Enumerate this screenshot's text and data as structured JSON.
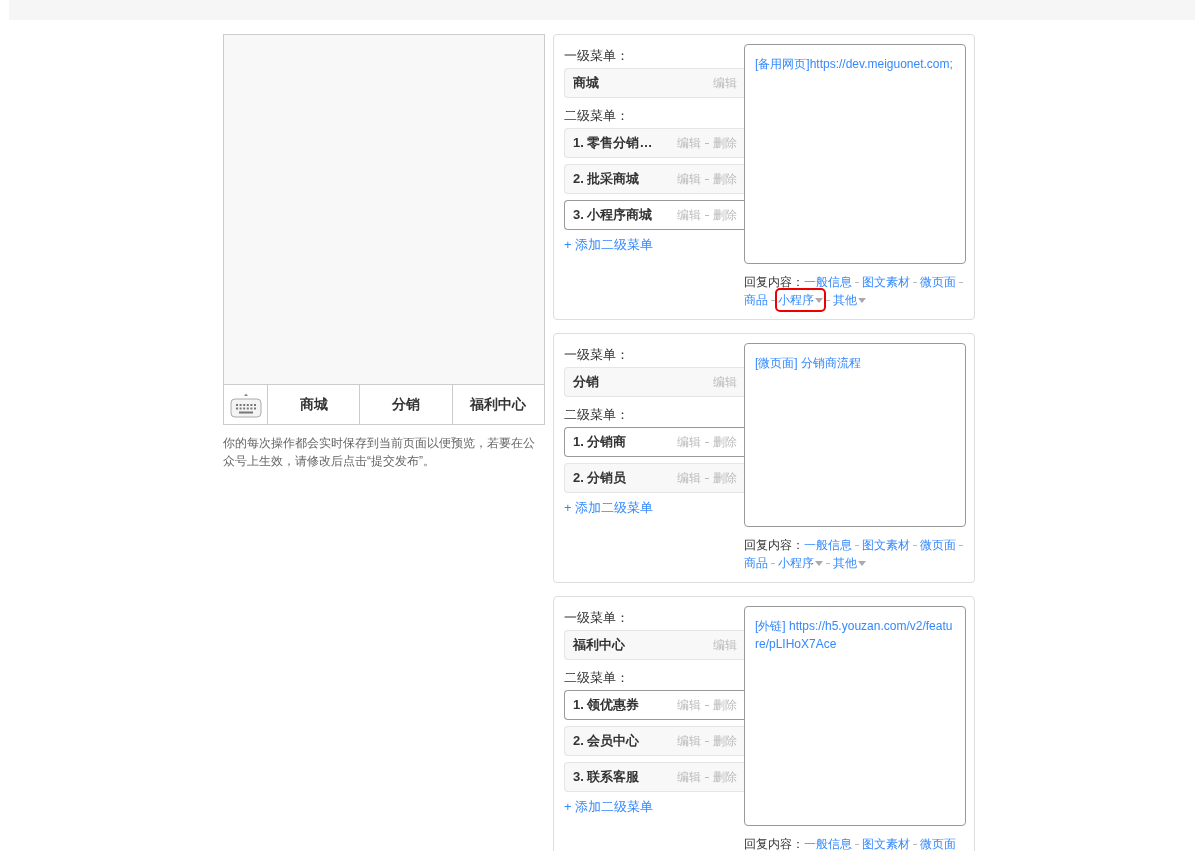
{
  "phone": {
    "menu_bar": [
      {
        "label": "商城"
      },
      {
        "label": "分销"
      },
      {
        "label": "福利中心"
      }
    ],
    "note": "你的每次操作都会实时保存到当前页面以便预览，若要在公众号上生效，请修改后点击“提交发布”。"
  },
  "cards": [
    {
      "level1_label": "一级菜单：",
      "level1": {
        "name": "商城",
        "action": "编辑"
      },
      "level2_label": "二级菜单：",
      "items": [
        {
          "name": "1. 零售分销…",
          "actions": [
            "编辑",
            "删除"
          ],
          "selected": false
        },
        {
          "name": "2. 批采商城",
          "actions": [
            "编辑",
            "删除"
          ],
          "selected": false
        },
        {
          "name": "3. 小程序商城",
          "actions": [
            "编辑",
            "删除"
          ],
          "selected": true
        }
      ],
      "add_label": "+ 添加二级菜单",
      "link": "[备用网页]https://dev.meiguonet.com;",
      "reply_label": "回复内容：",
      "reply_options": [
        {
          "label": "一般信息",
          "dropdown": false,
          "highlighted": false
        },
        {
          "label": "图文素材",
          "dropdown": false,
          "highlighted": false
        },
        {
          "label": "微页面",
          "dropdown": false,
          "highlighted": false
        },
        {
          "label": "商品",
          "dropdown": false,
          "highlighted": false
        },
        {
          "label": "小程序",
          "dropdown": true,
          "highlighted": true
        },
        {
          "label": "其他",
          "dropdown": true,
          "highlighted": false
        }
      ]
    },
    {
      "level1_label": "一级菜单：",
      "level1": {
        "name": "分销",
        "action": "编辑"
      },
      "level2_label": "二级菜单：",
      "items": [
        {
          "name": "1. 分销商",
          "actions": [
            "编辑",
            "删除"
          ],
          "selected": true
        },
        {
          "name": "2. 分销员",
          "actions": [
            "编辑",
            "删除"
          ],
          "selected": false
        }
      ],
      "add_label": "+ 添加二级菜单",
      "link": "[微页面] 分销商流程",
      "reply_label": "回复内容：",
      "reply_options": [
        {
          "label": "一般信息",
          "dropdown": false,
          "highlighted": false
        },
        {
          "label": "图文素材",
          "dropdown": false,
          "highlighted": false
        },
        {
          "label": "微页面",
          "dropdown": false,
          "highlighted": false
        },
        {
          "label": "商品",
          "dropdown": false,
          "highlighted": false
        },
        {
          "label": "小程序",
          "dropdown": true,
          "highlighted": false
        },
        {
          "label": "其他",
          "dropdown": true,
          "highlighted": false
        }
      ]
    },
    {
      "level1_label": "一级菜单：",
      "level1": {
        "name": "福利中心",
        "action": "编辑"
      },
      "level2_label": "二级菜单：",
      "items": [
        {
          "name": "1. 领优惠券",
          "actions": [
            "编辑",
            "删除"
          ],
          "selected": true
        },
        {
          "name": "2. 会员中心",
          "actions": [
            "编辑",
            "删除"
          ],
          "selected": false
        },
        {
          "name": "3. 联系客服",
          "actions": [
            "编辑",
            "删除"
          ],
          "selected": false
        }
      ],
      "add_label": "+ 添加二级菜单",
      "link": "[外链] https://h5.youzan.com/v2/feature/pLIHoX7Ace",
      "reply_label": "回复内容：",
      "reply_options": [
        {
          "label": "一般信息",
          "dropdown": false,
          "highlighted": false
        },
        {
          "label": "图文素材",
          "dropdown": false,
          "highlighted": false
        },
        {
          "label": "微页面",
          "dropdown": false,
          "highlighted": false
        }
      ]
    }
  ]
}
